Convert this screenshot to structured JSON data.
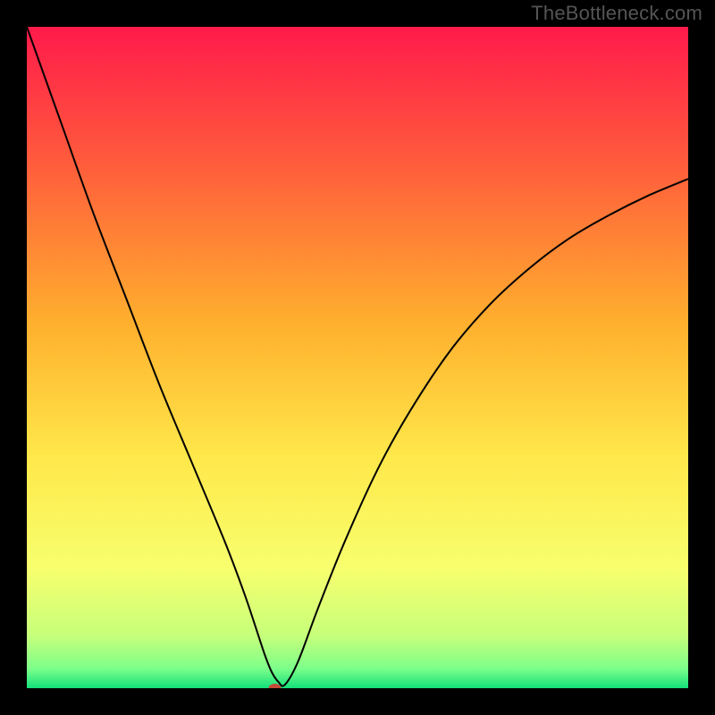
{
  "watermark": "TheBottleneck.com",
  "chart_data": {
    "type": "line",
    "title": "",
    "xlabel": "",
    "ylabel": "",
    "xlim": [
      0,
      100
    ],
    "ylim": [
      0,
      100
    ],
    "gradient_stops": [
      {
        "offset": 0,
        "color": "#ff1a4b"
      },
      {
        "offset": 0.2,
        "color": "#ff5a3c"
      },
      {
        "offset": 0.45,
        "color": "#ffb02e"
      },
      {
        "offset": 0.65,
        "color": "#ffe84a"
      },
      {
        "offset": 0.82,
        "color": "#f7ff6e"
      },
      {
        "offset": 0.92,
        "color": "#c7ff7a"
      },
      {
        "offset": 0.97,
        "color": "#7dff8a"
      },
      {
        "offset": 1.0,
        "color": "#14e07a"
      }
    ],
    "marker": {
      "x": 37.5,
      "y": 0,
      "color": "#c44a3a"
    },
    "series": [
      {
        "name": "curve",
        "x": [
          0,
          5,
          10,
          15,
          20,
          25,
          30,
          33,
          35,
          36,
          37,
          38,
          39,
          41,
          44,
          48,
          53,
          58,
          64,
          70,
          76,
          82,
          88,
          94,
          100
        ],
        "y": [
          100,
          86,
          72,
          59,
          46,
          34,
          22,
          14,
          8,
          5,
          2.5,
          1,
          0.5,
          4,
          12,
          22,
          33,
          42,
          51,
          58,
          63.5,
          68,
          71.5,
          74.5,
          77
        ]
      }
    ]
  }
}
